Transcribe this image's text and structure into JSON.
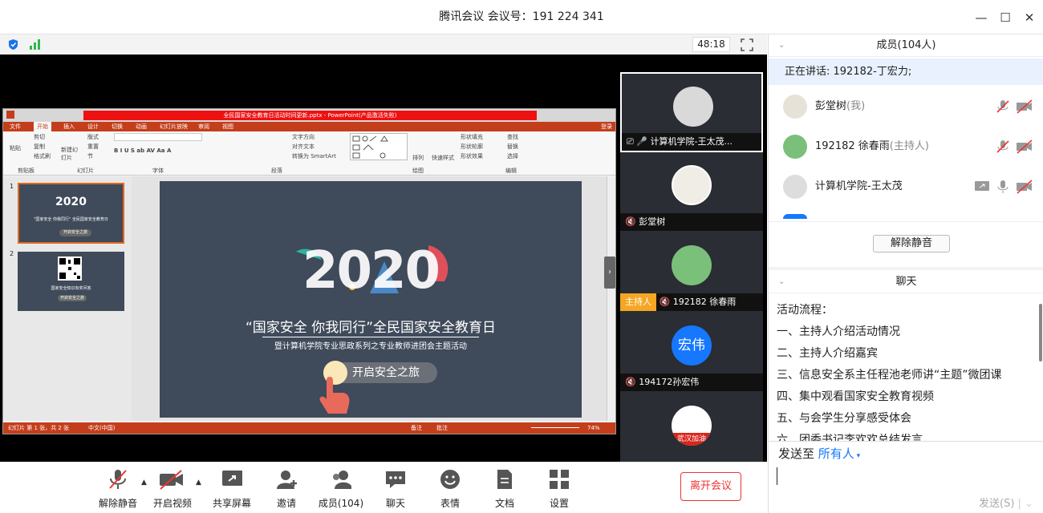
{
  "title_bar": {
    "title": "腾讯会议 会议号：191 224 341"
  },
  "stage": {
    "timer": "48:18",
    "ppt": {
      "window_title": "全民国家安全教育日活动时间更新.pptx - PowerPoint(产品激活失败)",
      "tabs": [
        "文件",
        "开始",
        "插入",
        "设计",
        "切换",
        "动画",
        "幻灯片放映",
        "审阅",
        "视图"
      ],
      "login": "登录",
      "ribbon_groups": [
        "剪贴板",
        "幻灯片",
        "字体",
        "段落",
        "绘图",
        "编辑"
      ],
      "ribbon_items": [
        "剪切",
        "复制",
        "格式刷",
        "粘贴",
        "版式",
        "重置",
        "节",
        "新建幻灯片",
        "文字方向",
        "对齐文本",
        "转换为 SmartArt",
        "形状填充",
        "形状轮廓",
        "形状效果",
        "排列",
        "快速样式",
        "查找",
        "替换",
        "选择"
      ],
      "thumb_numbers": [
        "1",
        "2"
      ],
      "thumb1_caption": "\"国家安全 你我同行\" 全民国家安全教育日",
      "thumb1_button": "开启安全之旅",
      "thumb2_caption": "国家安全知识有奖问答",
      "thumb2_button": "开启安全之旅",
      "slide": {
        "year": "2020",
        "headline": "“国家安全 你我同行”全民国家安全教育日",
        "subtitle": "暨计算机学院专业思政系列之专业教师进团会主题活动",
        "button": "开启安全之旅"
      },
      "status_left": "幻灯片 第 1 张，共 2 张",
      "status_lang": "中文(中国)",
      "status_notes": "备注",
      "status_comments": "批注",
      "zoom": "74%"
    }
  },
  "video_strip": [
    {
      "name": "计算机学院-王太茂...",
      "tag": ""
    },
    {
      "name": "彭堂树",
      "tag": ""
    },
    {
      "name": "192182 徐春雨",
      "tag": "主持人"
    },
    {
      "name": "194172孙宏伟",
      "tag": "",
      "avatar_text": "宏伟"
    },
    {
      "name": "",
      "tag": "",
      "avatar_text": "武汉加油"
    }
  ],
  "members": {
    "header": "成员(104人)",
    "speaking": "正在讲话: 192182-丁宏力;",
    "list": [
      {
        "name": "彭堂树",
        "suffix": "(我)"
      },
      {
        "name": "192182 徐春雨",
        "suffix": "(主持人)"
      },
      {
        "name": "计算机学院-王太茂",
        "suffix": ""
      }
    ],
    "unmute_all": "解除静音"
  },
  "chat": {
    "header": "聊天",
    "lines": [
      "活动流程：",
      "一、主持人介绍活动情况",
      "二、主持人介绍嘉宾",
      "三、信息安全系主任程池老师讲“主题”微团课",
      "四、集中观看国家安全教育视频",
      "五、与会学生分享感受体会",
      "六、团委书记李欢欢总结发言"
    ],
    "send_to_label": "发送至",
    "send_to_target": "所有人",
    "send_button": "发送(S)"
  },
  "toolbar": {
    "unmute": "解除静音",
    "video": "开启视频",
    "share": "共享屏幕",
    "invite": "邀请",
    "members": "成员(104)",
    "chat": "聊天",
    "emoji": "表情",
    "docs": "文档",
    "settings": "设置",
    "leave": "离开会议"
  },
  "colors": {
    "accent": "#0a6cff",
    "danger": "#e33333",
    "host_tag": "#f5a623",
    "ppt_red": "#c43e1c"
  }
}
